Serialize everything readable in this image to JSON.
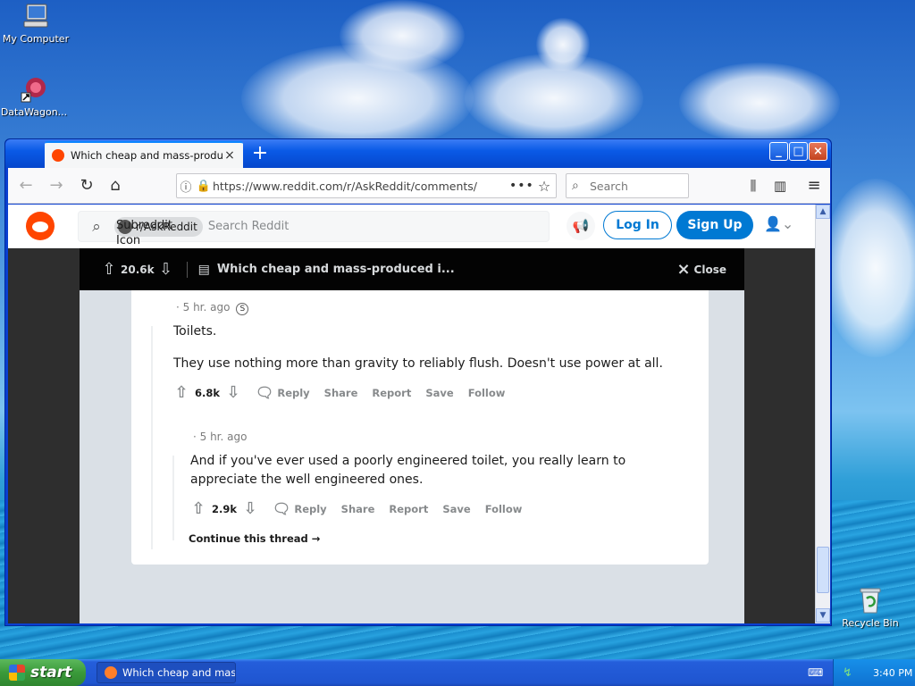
{
  "desktop": {
    "icons": [
      {
        "label": "My Computer"
      },
      {
        "label": "DataWagon..."
      },
      {
        "label": "Recycle Bin"
      }
    ]
  },
  "browser": {
    "tab_title": "Which cheap and mass-produced i",
    "tab_close": "×",
    "new_tab": "+",
    "url": "https://www.reddit.com/r/AskReddit/comments/",
    "search_placeholder": "Search"
  },
  "reddit": {
    "subreddit_chip": "r/AskReddit",
    "subreddit_icon_alt": "Subreddit Icon",
    "search_placeholder": "Search Reddit",
    "login_label": "Log In",
    "signup_label": "Sign Up",
    "post_bar": {
      "vote_count": "20.6k",
      "title": "Which cheap and mass-produced i...",
      "close_label": "Close"
    },
    "comments": [
      {
        "time": "· 5 hr. ago",
        "paragraphs": [
          "Toilets.",
          "They use nothing more than gravity to reliably flush. Doesn't use power at all."
        ],
        "votes": "6.8k",
        "actions": [
          "Reply",
          "Share",
          "Report",
          "Save",
          "Follow"
        ]
      },
      {
        "time": "· 5 hr. ago",
        "paragraphs": [
          "And if you've ever used a poorly engineered toilet, you really learn to appreciate the well engineered ones."
        ],
        "votes": "2.9k",
        "actions": [
          "Reply",
          "Share",
          "Report",
          "Save",
          "Follow"
        ]
      }
    ],
    "continue_thread": "Continue this thread"
  },
  "taskbar": {
    "start_label": "start",
    "task_item": "Which cheap and mas...",
    "clock": "3:40 PM"
  },
  "colors": {
    "reddit_orange": "#ff4500",
    "reddit_blue": "#0079d3",
    "xp_blue": "#245edb",
    "start_green": "#3a9a3a"
  }
}
